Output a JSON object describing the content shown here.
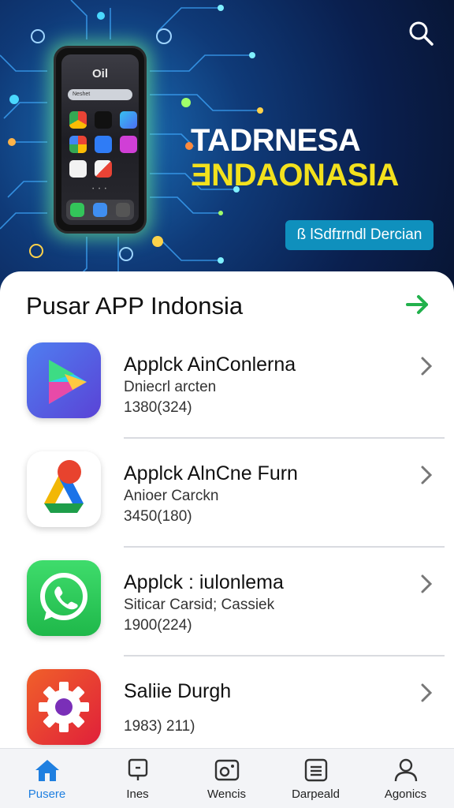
{
  "hero": {
    "title": "TADRNESA",
    "subtitle": "ƎNDAONASIA",
    "chip_label": "ß lSdfɪrndl Dercian",
    "phone": {
      "time": "Oil",
      "search_text": "Neshet"
    }
  },
  "section": {
    "title": "Pusar APP Indonsia"
  },
  "apps": [
    {
      "name": "Applck AinConlerna",
      "developer": "Dniecrl arcten",
      "meta": "1380(324)",
      "icon": "play-store-icon",
      "color": "#4a63e6"
    },
    {
      "name": "Applck AlnCne Furn",
      "developer": "Anioer Carckn",
      "meta": "3450(180)",
      "icon": "drive-icon",
      "color": "#ffffff"
    },
    {
      "name": "Applck : iulonlema",
      "developer": "Siticar Carsid; Cassiek",
      "meta": "1900(224)",
      "icon": "whatsapp-icon",
      "color": "#25c452"
    },
    {
      "name": "Saliie Durgh",
      "developer": "",
      "meta": "1983) 211)",
      "icon": "settings-gear-icon",
      "color": "#e9422a"
    }
  ],
  "tabs": [
    {
      "label": "Pusere",
      "icon": "home-icon",
      "active": true
    },
    {
      "label": "Ines",
      "icon": "apps-icon",
      "active": false
    },
    {
      "label": "Wencis",
      "icon": "media-icon",
      "active": false
    },
    {
      "label": "Darpeald",
      "icon": "list-icon",
      "active": false
    },
    {
      "label": "Agonics",
      "icon": "profile-icon",
      "active": false
    }
  ],
  "colors": {
    "accent_green": "#22b14c",
    "active_tab": "#1f7fe0",
    "hero_title_yellow": "#f3e11d",
    "chip_blue": "#0f90bd"
  }
}
